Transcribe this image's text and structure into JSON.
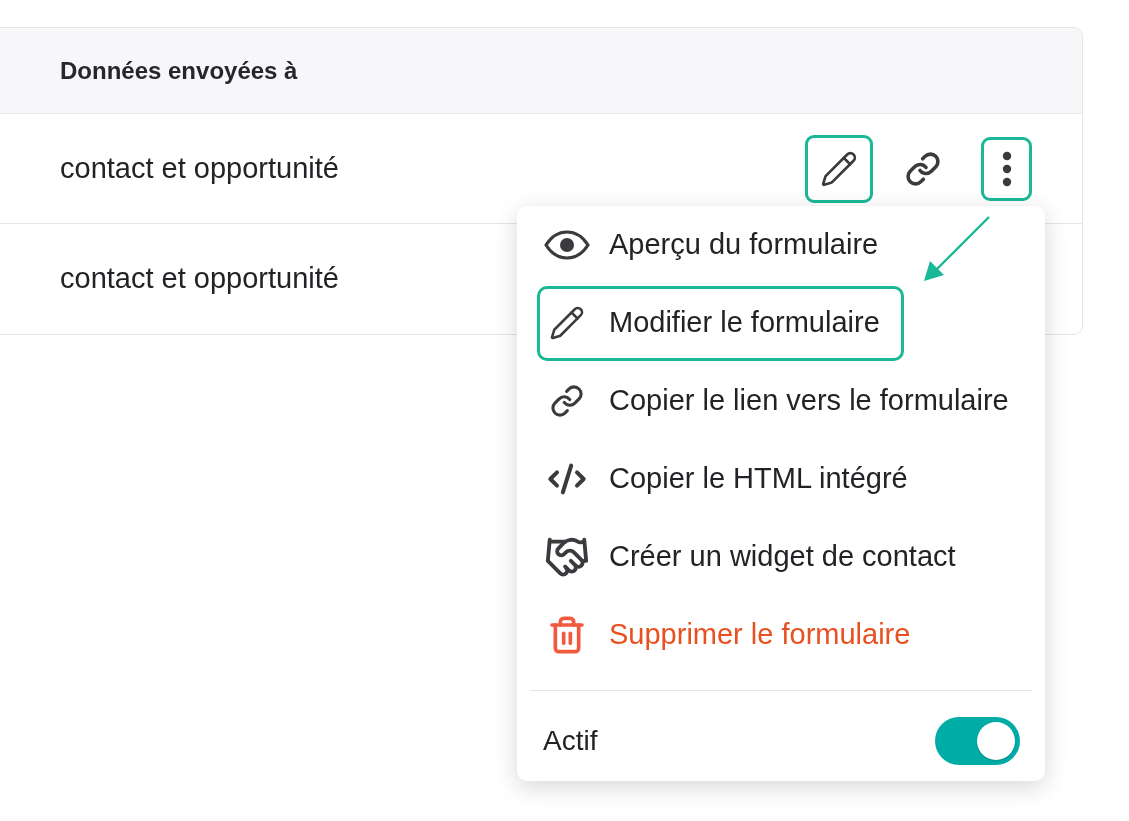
{
  "table": {
    "columns": [
      "Données envoyées à"
    ],
    "rows": [
      {
        "cells": [
          "contact et opportunité"
        ],
        "actions": [
          {
            "kind": "edit",
            "highlighted": true
          },
          {
            "kind": "link",
            "highlighted": false
          },
          {
            "kind": "more",
            "highlighted": true
          }
        ]
      },
      {
        "cells": [
          "contact et opportunité"
        ]
      }
    ]
  },
  "menu": {
    "items": [
      {
        "kind": "preview",
        "label": "Aperçu du formulaire",
        "highlighted": false,
        "danger": false
      },
      {
        "kind": "edit",
        "label": "Modifier le formulaire",
        "highlighted": true,
        "danger": false
      },
      {
        "kind": "link",
        "label": "Copier le lien vers le formulaire",
        "highlighted": false,
        "danger": false
      },
      {
        "kind": "embed",
        "label": "Copier le HTML intégré",
        "highlighted": false,
        "danger": false
      },
      {
        "kind": "widget",
        "label": "Créer un widget de contact",
        "highlighted": false,
        "danger": false
      },
      {
        "kind": "delete",
        "label": "Supprimer le formulaire",
        "highlighted": false,
        "danger": true
      }
    ],
    "active": {
      "label": "Actif",
      "on": true
    }
  }
}
